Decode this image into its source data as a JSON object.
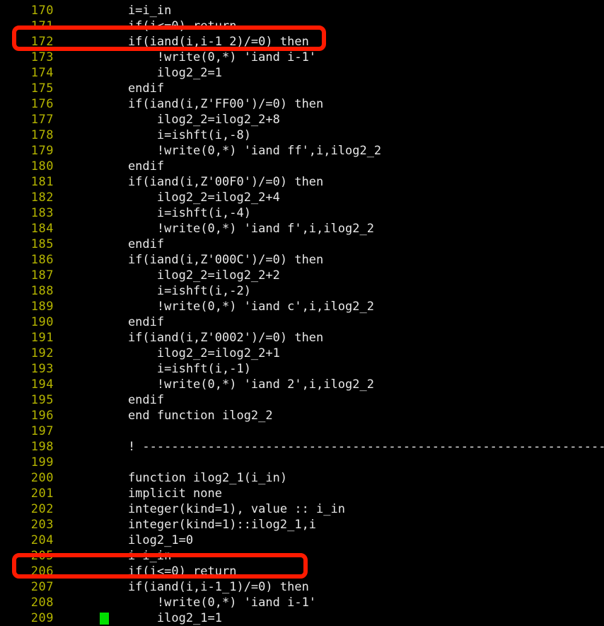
{
  "editor": {
    "kind": "terminal-code-listing",
    "background_color": "#000000",
    "line_number_color": "#b5b500",
    "code_text_color": "#e8e8e8",
    "cursor_color": "#00e000",
    "highlight_color": "#fe1a00",
    "cursor": {
      "line_number": "209",
      "column_char_index": 0
    },
    "lines": [
      {
        "num": "170",
        "text": "    i=i_in"
      },
      {
        "num": "171",
        "text": "    if(i<=0) return"
      },
      {
        "num": "172",
        "text": "    if(iand(i,i-1_2)/=0) then"
      },
      {
        "num": "173",
        "text": "        !write(0,*) 'iand i-1'"
      },
      {
        "num": "174",
        "text": "        ilog2_2=1"
      },
      {
        "num": "175",
        "text": "    endif"
      },
      {
        "num": "176",
        "text": "    if(iand(i,Z'FF00')/=0) then"
      },
      {
        "num": "177",
        "text": "        ilog2_2=ilog2_2+8"
      },
      {
        "num": "178",
        "text": "        i=ishft(i,-8)"
      },
      {
        "num": "179",
        "text": "        !write(0,*) 'iand ff',i,ilog2_2"
      },
      {
        "num": "180",
        "text": "    endif"
      },
      {
        "num": "181",
        "text": "    if(iand(i,Z'00F0')/=0) then"
      },
      {
        "num": "182",
        "text": "        ilog2_2=ilog2_2+4"
      },
      {
        "num": "183",
        "text": "        i=ishft(i,-4)"
      },
      {
        "num": "184",
        "text": "        !write(0,*) 'iand f',i,ilog2_2"
      },
      {
        "num": "185",
        "text": "    endif"
      },
      {
        "num": "186",
        "text": "    if(iand(i,Z'000C')/=0) then"
      },
      {
        "num": "187",
        "text": "        ilog2_2=ilog2_2+2"
      },
      {
        "num": "188",
        "text": "        i=ishft(i,-2)"
      },
      {
        "num": "189",
        "text": "        !write(0,*) 'iand c',i,ilog2_2"
      },
      {
        "num": "190",
        "text": "    endif"
      },
      {
        "num": "191",
        "text": "    if(iand(i,Z'0002')/=0) then"
      },
      {
        "num": "192",
        "text": "        ilog2_2=ilog2_2+1"
      },
      {
        "num": "193",
        "text": "        i=ishft(i,-1)"
      },
      {
        "num": "194",
        "text": "        !write(0,*) 'iand 2',i,ilog2_2"
      },
      {
        "num": "195",
        "text": "    endif"
      },
      {
        "num": "196",
        "text": "    end function ilog2_2"
      },
      {
        "num": "197",
        "text": ""
      },
      {
        "num": "198",
        "text": "    ! ---------------------------------------------------------------------------"
      },
      {
        "num": "199",
        "text": ""
      },
      {
        "num": "200",
        "text": "    function ilog2_1(i_in)"
      },
      {
        "num": "201",
        "text": "    implicit none"
      },
      {
        "num": "202",
        "text": "    integer(kind=1), value :: i_in"
      },
      {
        "num": "203",
        "text": "    integer(kind=1)::ilog2_1,i"
      },
      {
        "num": "204",
        "text": "    ilog2_1=0"
      },
      {
        "num": "205",
        "text": "    i=i_in"
      },
      {
        "num": "206",
        "text": "    if(i<=0) return"
      },
      {
        "num": "207",
        "text": "    if(iand(i,i-1_1)/=0) then"
      },
      {
        "num": "208",
        "text": "        !write(0,*) 'iand i-1'"
      },
      {
        "num": "209",
        "text": "        ilog2_1=1"
      }
    ],
    "highlights": [
      {
        "id": "172",
        "label": "highlight-line-172",
        "line_number": "172"
      },
      {
        "id": "207",
        "label": "highlight-line-207",
        "line_number": "207"
      }
    ]
  }
}
